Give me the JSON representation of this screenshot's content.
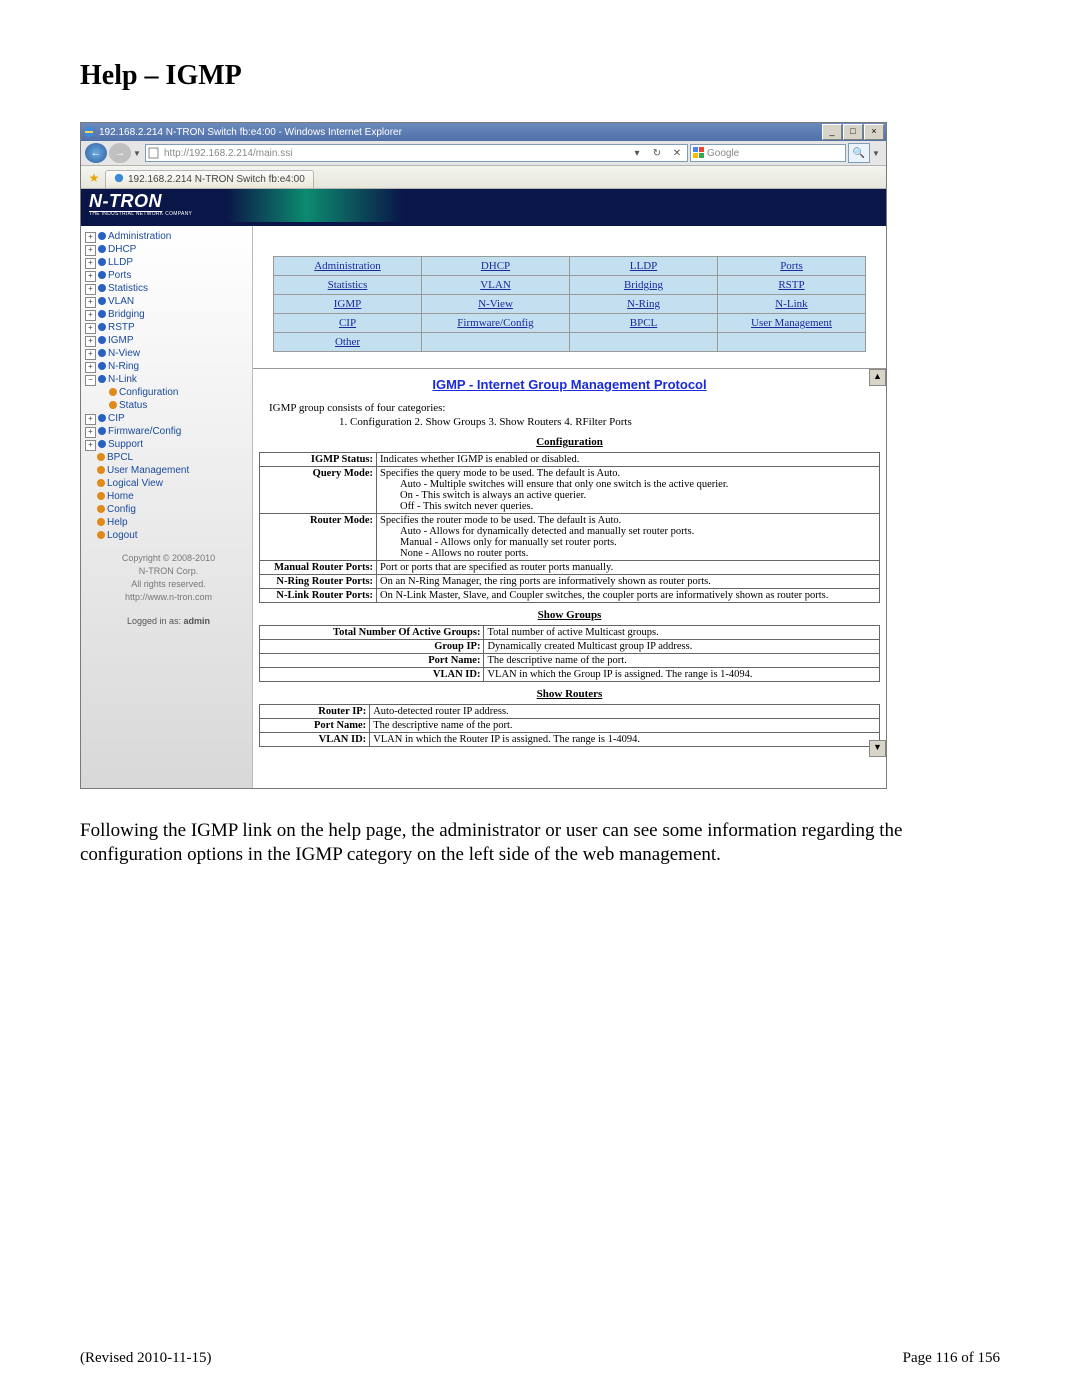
{
  "doc": {
    "title": "Help – IGMP",
    "paragraph": "Following the IGMP link on the help page, the administrator or user can see some information regarding the configuration options in the IGMP category on the left side of the web management.",
    "revised": "(Revised 2010-11-15)",
    "page": "Page 116 of 156"
  },
  "browser": {
    "title": "192.168.2.214 N-TRON Switch fb:e4:00 - Windows Internet Explorer",
    "url": "http://192.168.2.214/main.ssi",
    "search_provider": "Google",
    "tab_text": "192.168.2.214 N-TRON Switch fb:e4:00"
  },
  "logo": {
    "brand": "N-TRON",
    "tag": "THE INDUSTRIAL NETWORK COMPANY"
  },
  "tree": [
    {
      "t": "p",
      "d": "blue",
      "label": "Administration"
    },
    {
      "t": "p",
      "d": "blue",
      "label": "DHCP"
    },
    {
      "t": "p",
      "d": "blue",
      "label": "LLDP"
    },
    {
      "t": "p",
      "d": "blue",
      "label": "Ports"
    },
    {
      "t": "p",
      "d": "blue",
      "label": "Statistics"
    },
    {
      "t": "p",
      "d": "blue",
      "label": "VLAN"
    },
    {
      "t": "p",
      "d": "blue",
      "label": "Bridging"
    },
    {
      "t": "p",
      "d": "blue",
      "label": "RSTP"
    },
    {
      "t": "p",
      "d": "blue",
      "label": "IGMP"
    },
    {
      "t": "p",
      "d": "blue",
      "label": "N-View"
    },
    {
      "t": "p",
      "d": "blue",
      "label": "N-Ring"
    },
    {
      "t": "m",
      "d": "blue",
      "label": "N-Link"
    },
    {
      "t": "c",
      "d": "orange",
      "label": "Configuration"
    },
    {
      "t": "c",
      "d": "orange",
      "label": "Status"
    },
    {
      "t": "p",
      "d": "blue",
      "label": "CIP"
    },
    {
      "t": "p",
      "d": "blue",
      "label": "Firmware/Config"
    },
    {
      "t": "p",
      "d": "blue",
      "label": "Support"
    },
    {
      "t": "l",
      "d": "orange",
      "label": "BPCL"
    },
    {
      "t": "l",
      "d": "orange",
      "label": "User Management"
    },
    {
      "t": "l",
      "d": "orange",
      "label": "Logical View"
    },
    {
      "t": "l",
      "d": "orange",
      "label": "Home"
    },
    {
      "t": "l",
      "d": "orange",
      "label": "Config"
    },
    {
      "t": "l",
      "d": "orange",
      "label": "Help"
    },
    {
      "t": "l",
      "d": "orange",
      "label": "Logout"
    }
  ],
  "copyright": {
    "line1": "Copyright © 2008-2010",
    "line2": "N-TRON Corp.",
    "line3": "All rights reserved.",
    "url": "http://www.n-tron.com"
  },
  "login": {
    "text": "Logged in as:",
    "user": "admin"
  },
  "help_grid": [
    [
      "Administration",
      "DHCP",
      "LLDP",
      "Ports"
    ],
    [
      "Statistics",
      "VLAN",
      "Bridging",
      "RSTP"
    ],
    [
      "IGMP",
      "N-View",
      "N-Ring",
      "N-Link"
    ],
    [
      "CIP",
      "Firmware/Config",
      "BPCL",
      "User Management"
    ],
    [
      "Other",
      "",
      "",
      ""
    ]
  ],
  "help": {
    "title": "IGMP - Internet Group Management Protocol",
    "intro": "IGMP group consists of four categories:",
    "intro_items": "1. Configuration   2. Show Groups   3. Show Routers   4. RFilter Ports",
    "sections": [
      {
        "head": "Configuration",
        "rows": [
          {
            "k": "IGMP Status:",
            "v": "Indicates whether IGMP is enabled or disabled."
          },
          {
            "k": "Query Mode:",
            "v": "Specifies the query mode to be used. The default is Auto.\nAuto - Multiple switches will ensure that only one switch is the active querier.\nOn - This switch is always an active querier.\nOff - This switch never queries."
          },
          {
            "k": "Router Mode:",
            "v": "Specifies the router mode to be used. The default is Auto.\nAuto - Allows for dynamically detected and manually set router ports.\nManual - Allows only for manually set router ports.\nNone - Allows no router ports."
          },
          {
            "k": "Manual Router Ports:",
            "v": "Port or ports that are specified as router ports manually."
          },
          {
            "k": "N-Ring Router Ports:",
            "v": "On an N-Ring Manager, the ring ports are informatively shown as router ports."
          },
          {
            "k": "N-Link Router Ports:",
            "v": "On N-Link Master, Slave, and Coupler switches, the coupler ports are informatively shown as router ports."
          }
        ]
      },
      {
        "head": "Show Groups",
        "rows": [
          {
            "k": "Total Number Of Active Groups:",
            "v": "Total number of active Multicast groups."
          },
          {
            "k": "Group IP:",
            "v": "Dynamically created Multicast group IP address."
          },
          {
            "k": "Port Name:",
            "v": "The descriptive name of the port."
          },
          {
            "k": "VLAN ID:",
            "v": "VLAN in which the Group IP is assigned. The range is 1-4094."
          }
        ]
      },
      {
        "head": "Show Routers",
        "rows": [
          {
            "k": "Router IP:",
            "v": "Auto-detected router IP address."
          },
          {
            "k": "Port Name:",
            "v": "The descriptive name of the port."
          },
          {
            "k": "VLAN ID:",
            "v": "VLAN in which the Router IP is assigned. The range is 1-4094."
          }
        ]
      }
    ]
  }
}
